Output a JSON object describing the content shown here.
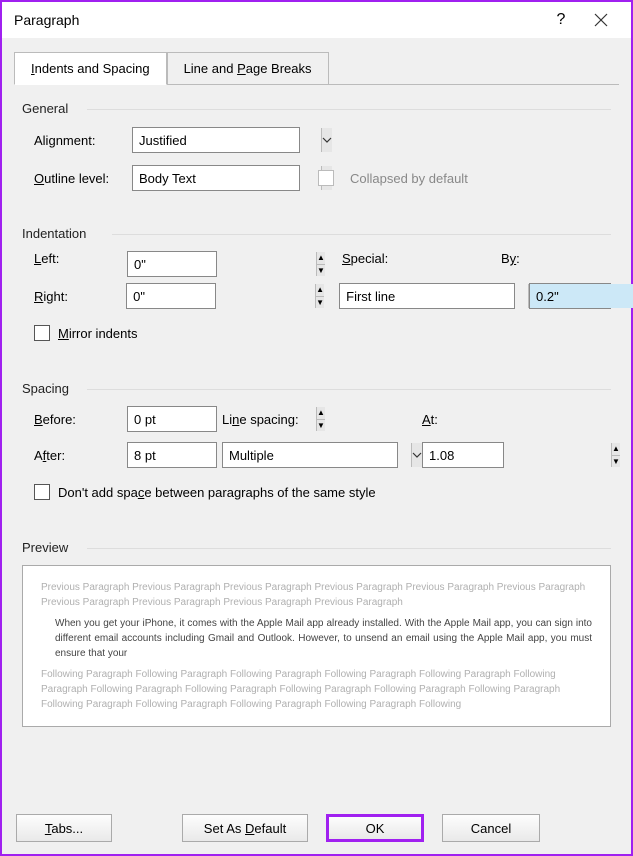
{
  "title": "Paragraph",
  "tabs": {
    "indents": "Indents and Spacing",
    "breaks": "Line and Page Breaks"
  },
  "general": {
    "header": "General",
    "alignment_label": "Alignment:",
    "alignment_value": "Justified",
    "outline_label": "Outline level:",
    "outline_value": "Body Text",
    "collapsed_label": "Collapsed by default"
  },
  "indentation": {
    "header": "Indentation",
    "left_label": "Left:",
    "left_value": "0\"",
    "right_label": "Right:",
    "right_value": "0\"",
    "special_label": "Special:",
    "special_value": "First line",
    "by_label": "By:",
    "by_value": "0.2\"",
    "mirror_label": "Mirror indents"
  },
  "spacing": {
    "header": "Spacing",
    "before_label": "Before:",
    "before_value": "0 pt",
    "after_label": "After:",
    "after_value": "8 pt",
    "line_label": "Line spacing:",
    "line_value": "Multiple",
    "at_label": "At:",
    "at_value": "1.08",
    "noadd_label": "Don't add space between paragraphs of the same style"
  },
  "preview": {
    "header": "Preview",
    "prev_text": "Previous Paragraph Previous Paragraph Previous Paragraph Previous Paragraph Previous Paragraph Previous Paragraph Previous Paragraph Previous Paragraph Previous Paragraph Previous Paragraph",
    "sample_text": "When you get your iPhone, it comes with the Apple Mail app already installed. With the Apple Mail app, you can sign into different email accounts including Gmail and Outlook. However, to unsend an email using the Apple Mail app, you must ensure that your",
    "follow_text": "Following Paragraph Following Paragraph Following Paragraph Following Paragraph Following Paragraph Following Paragraph Following Paragraph Following Paragraph Following Paragraph Following Paragraph Following Paragraph Following Paragraph Following Paragraph Following Paragraph Following Paragraph Following"
  },
  "buttons": {
    "tabs": "Tabs...",
    "default": "Set As Default",
    "ok": "OK",
    "cancel": "Cancel"
  }
}
